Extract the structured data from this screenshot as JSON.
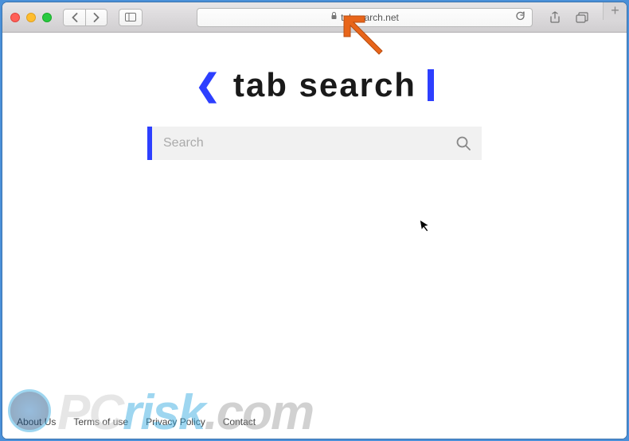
{
  "browser": {
    "url": "tabsearch.net"
  },
  "page": {
    "logo_text": "tab search",
    "search_placeholder": "Search"
  },
  "footer": {
    "links": [
      "About Us",
      "Terms of use",
      "Privacy Policy",
      "Contact"
    ]
  },
  "watermark": {
    "pc": "PC",
    "risk": "risk",
    "com": ".com"
  }
}
